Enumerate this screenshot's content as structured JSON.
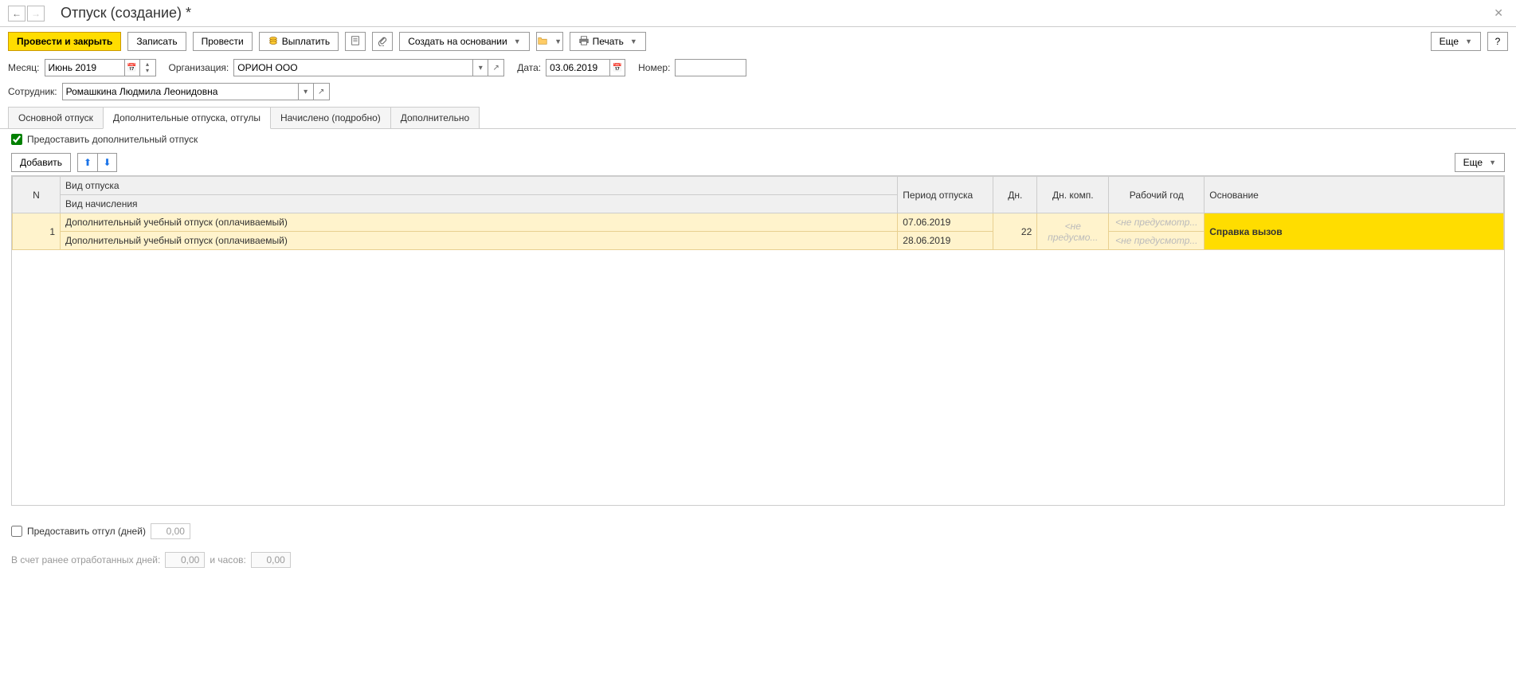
{
  "header": {
    "title": "Отпуск (создание) *"
  },
  "toolbar": {
    "post_and_close": "Провести и закрыть",
    "save": "Записать",
    "post": "Провести",
    "pay": "Выплатить",
    "create_based": "Создать на основании",
    "print": "Печать",
    "more": "Еще",
    "help": "?"
  },
  "form": {
    "month_label": "Месяц:",
    "month_value": "Июнь 2019",
    "org_label": "Организация:",
    "org_value": "ОРИОН ООО",
    "date_label": "Дата:",
    "date_value": "03.06.2019",
    "number_label": "Номер:",
    "number_value": "",
    "employee_label": "Сотрудник:",
    "employee_value": "Ромашкина Людмила Леонидовна"
  },
  "tabs": {
    "main": "Основной отпуск",
    "additional": "Дополнительные отпуска, отгулы",
    "accrued": "Начислено (подробно)",
    "extra": "Дополнительно"
  },
  "checkbox": {
    "provide_additional": "Предоставить дополнительный отпуск"
  },
  "table_toolbar": {
    "add": "Добавить",
    "more": "Еще"
  },
  "table": {
    "headers": {
      "n": "N",
      "type": "Вид отпуска",
      "accrual_type": "Вид начисления",
      "period": "Период отпуска",
      "days": "Дн.",
      "days_comp": "Дн. комп.",
      "work_year": "Рабочий год",
      "basis": "Основание"
    },
    "row": {
      "n": "1",
      "type": "Дополнительный учебный отпуск (оплачиваемый)",
      "accrual": "Дополнительный учебный отпуск (оплачиваемый)",
      "period_from": "07.06.2019",
      "period_to": "28.06.2019",
      "days": "22",
      "comp_placeholder": "<не предусмо...",
      "year_placeholder": "<не предусмотр...",
      "basis": "Справка вызов"
    }
  },
  "footer": {
    "provide_time_off": "Предоставить отгул (дней)",
    "time_off_value": "0,00",
    "worked_days_label": "В счет ранее отработанных дней:",
    "worked_days_value": "0,00",
    "hours_label": "и часов:",
    "hours_value": "0,00"
  }
}
